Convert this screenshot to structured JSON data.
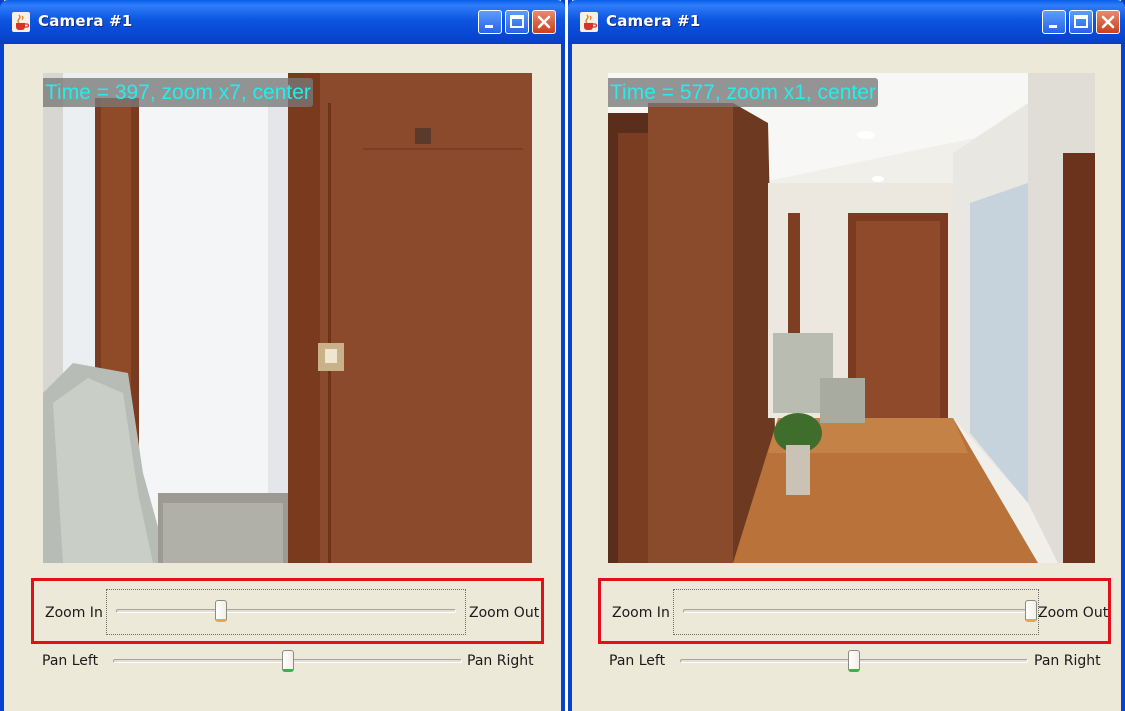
{
  "windows": [
    {
      "title": "Camera #1",
      "overlay_text": "Time = 397, zoom x7, center",
      "zoom": {
        "left_label": "Zoom In",
        "right_label": "Zoom Out",
        "value": 0.31
      },
      "pan": {
        "left_label": "Pan Left",
        "right_label": "Pan Right",
        "value": 0.5
      }
    },
    {
      "title": "Camera #1",
      "overlay_text": "Time = 577, zoom x1, center",
      "zoom": {
        "left_label": "Zoom In",
        "right_label": "Zoom Out",
        "value": 1.0
      },
      "pan": {
        "left_label": "Pan Left",
        "right_label": "Pan Right",
        "value": 0.5
      }
    }
  ],
  "icons": {
    "window_icon": "java-coffee-cup-icon",
    "minimize": "minimize-icon",
    "maximize": "maximize-icon",
    "close": "close-icon"
  },
  "colors": {
    "titlebar": "#0847d2",
    "overlay_text": "#27ecec",
    "zoom_highlight": "#e0111b",
    "window_background": "#ece9d8"
  }
}
